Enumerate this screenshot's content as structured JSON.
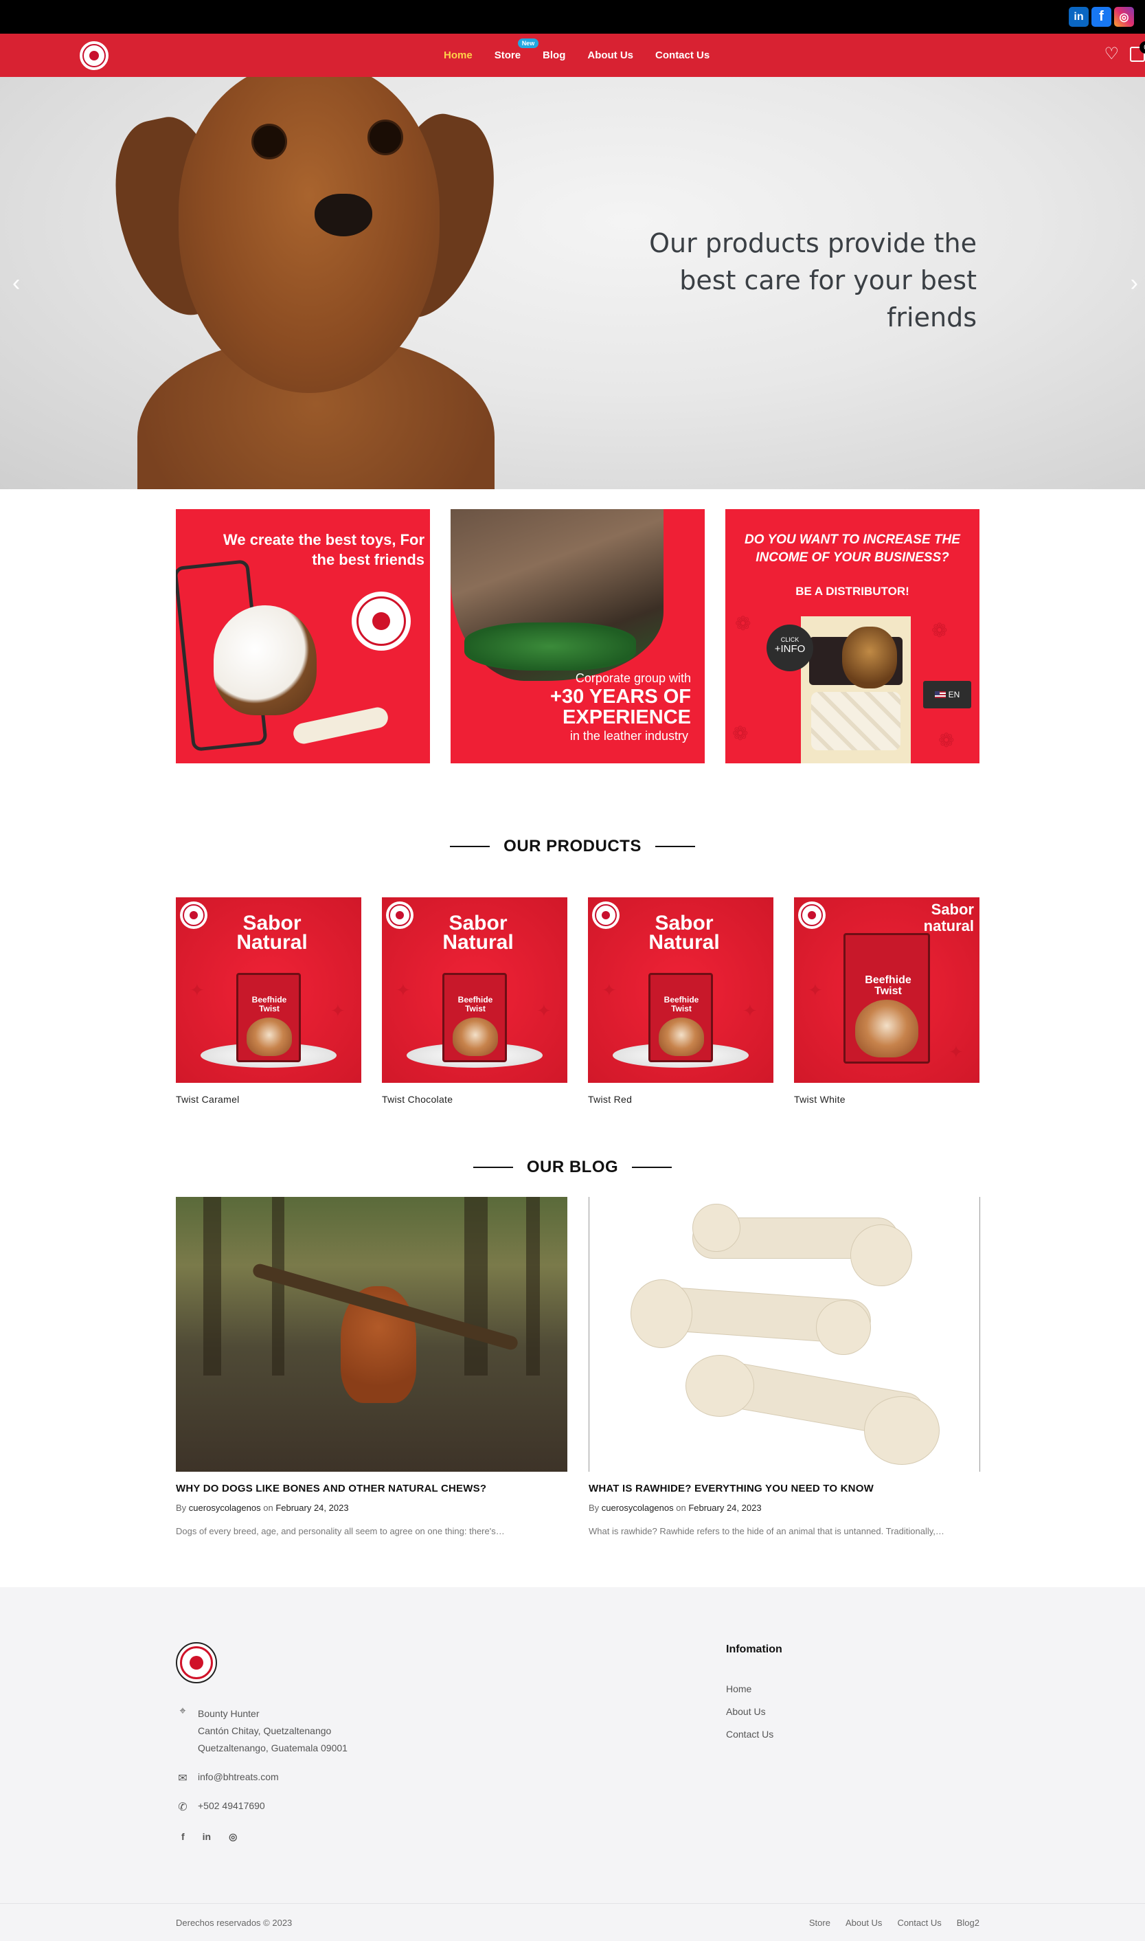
{
  "social": [
    {
      "icon": "linkedin-icon",
      "glyph": "in"
    },
    {
      "icon": "facebook-icon",
      "glyph": "f"
    },
    {
      "icon": "instagram-icon",
      "glyph": "◎"
    }
  ],
  "nav": {
    "items": [
      {
        "label": "Home",
        "active": true
      },
      {
        "label": "Store"
      },
      {
        "label": "Blog"
      },
      {
        "label": "About Us"
      },
      {
        "label": "Contact Us"
      }
    ],
    "new_badge": "New",
    "cart_count": "0"
  },
  "hero": {
    "headline": "Our products provide the best care for your best friends",
    "prev": "‹",
    "next": "›"
  },
  "promos": {
    "p1_title": "We create the best toys, For the best friends",
    "p2_small": "Corporate group with",
    "p2_big": "+30 YEARS OF EXPERIENCE",
    "p2_small2": "in the leather industry",
    "p3_question": "DO YOU WANT TO INCREASE THE INCOME OF YOUR BUSINESS?",
    "p3_sub": "BE A DISTRIBUTOR!",
    "p3_click": "CLICK",
    "p3_info": "+INFO",
    "p3_lang": "EN"
  },
  "products_heading": "OUR PRODUCTS",
  "products": [
    {
      "name": "Twist Caramel",
      "banner": "Sabor Natural",
      "bag": "Beefhide Twist"
    },
    {
      "name": "Twist Chocolate",
      "banner": "Sabor Natural",
      "bag": "Beefhide Twist"
    },
    {
      "name": "Twist Red",
      "banner": "Sabor Natural",
      "bag": "Beefhide Twist"
    },
    {
      "name": "Twist White",
      "banner": "Sabor natural",
      "bag": "Beefhide Twist"
    }
  ],
  "blog_heading": "OUR BLOG",
  "posts": [
    {
      "title": "WHY DO DOGS LIKE BONES AND OTHER NATURAL CHEWS?",
      "by": "By",
      "author": "cuerosycolagenos",
      "on": "on",
      "date": "February 24, 2023",
      "excerpt": "Dogs of every breed, age, and personality all seem to agree on one thing: there's…"
    },
    {
      "title": "WHAT IS RAWHIDE? EVERYTHING YOU NEED TO KNOW",
      "by": "By",
      "author": "cuerosycolagenos",
      "on": "on",
      "date": "February 24, 2023",
      "excerpt": "What is rawhide? Rawhide refers to the hide of an animal that is untanned. Traditionally,…"
    }
  ],
  "footer": {
    "address_line1": "Bounty Hunter",
    "address_line2": "Cantón Chitay, Quetzaltenango",
    "address_line3": "Quetzaltenango, Guatemala 09001",
    "email": "info@bhtreats.com",
    "phone": "+502 49417690",
    "info_title": "Infomation",
    "info_links": [
      "Home",
      "About Us",
      "Contact Us"
    ],
    "copyright": "Derechos reservados © 2023",
    "bottom_links": [
      "Store",
      "About Us",
      "Contact Us",
      "Blog2"
    ],
    "social": [
      "f",
      "in",
      "◎"
    ]
  },
  "colors": {
    "brand_red": "#d82232",
    "active_nav": "#ffd24a",
    "badge_blue": "#22a8e0"
  }
}
